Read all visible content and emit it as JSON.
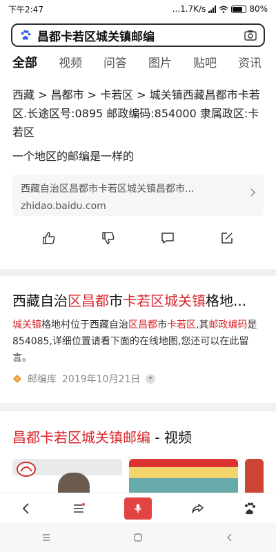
{
  "status": {
    "time": "下午2:47",
    "speed": "...1.7K/s",
    "battery": "80%"
  },
  "search": {
    "query": "昌都卡若区城关镇邮编"
  },
  "tabs": [
    "全部",
    "视频",
    "问答",
    "图片",
    "贴吧",
    "资讯"
  ],
  "result1": {
    "text": "西藏 > 昌都市 > 卡若区 > 城关镇西藏昌都市卡若区.长途区号:0895 邮政编码:854000 隶属政区:卡若区",
    "text2": "一个地区的邮编是一样的",
    "source_title": "西藏自治区昌都市卡若区城关镇昌都市...",
    "source_domain": "zhidao.baidu.com"
  },
  "result2": {
    "title_parts": [
      "西藏自治",
      "区",
      "昌都",
      "市",
      "卡若区",
      "城关镇",
      "格地..."
    ],
    "snippet_parts": [
      "城关镇",
      "格地村位于西藏自治",
      "区",
      "昌都",
      "市",
      "卡若区",
      ",其",
      "邮政编码",
      "是854085,详细位置请看下面的在线地图,您还可以在此留言。"
    ],
    "site": "邮编库",
    "date": "2019年10月21日"
  },
  "result3": {
    "title_red": "昌都卡若区城关镇邮编",
    "title_suffix": " - 视频"
  },
  "colors": {
    "accent_red": "#d7262a",
    "mic": "#e24444"
  }
}
